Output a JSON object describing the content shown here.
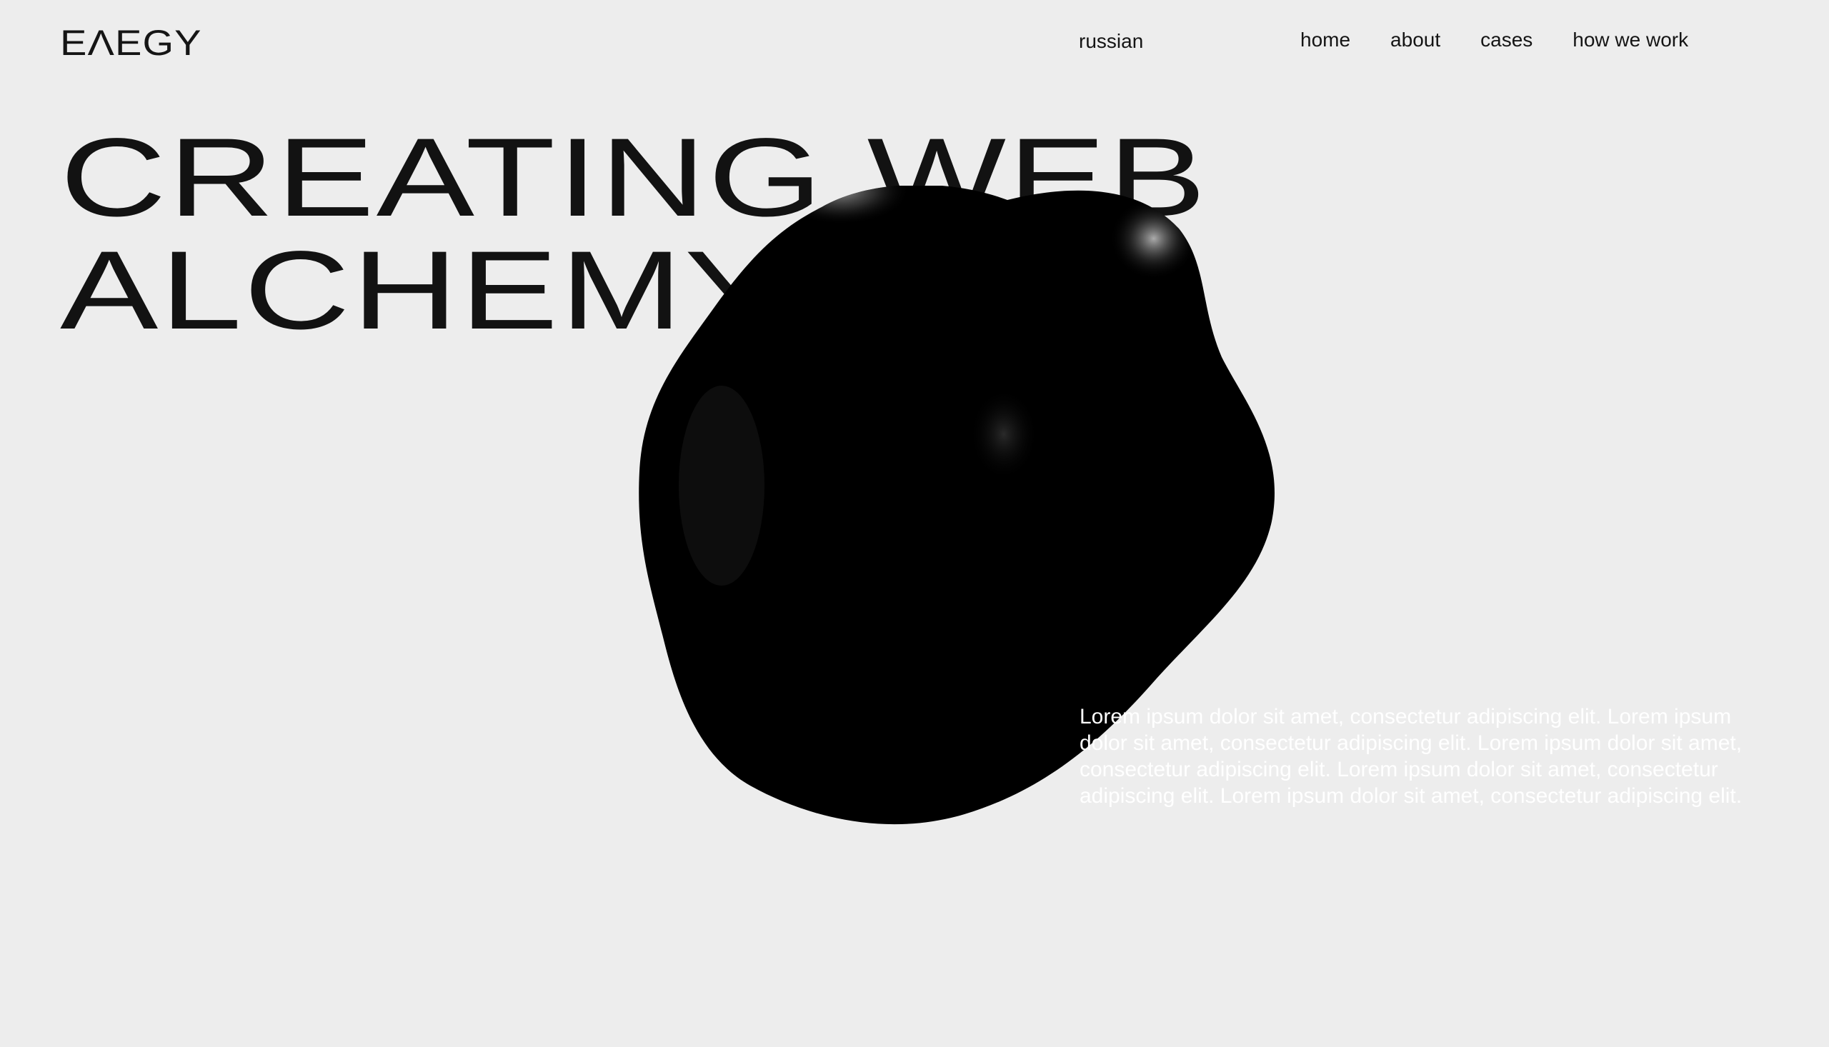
{
  "header": {
    "logo": "EΛEGY",
    "language_label": "russian",
    "nav": [
      {
        "label": "home"
      },
      {
        "label": "about"
      },
      {
        "label": "cases"
      },
      {
        "label": "how we work"
      }
    ]
  },
  "hero": {
    "title_line_1": "CREATING WEB",
    "title_line_2": "ALCHEMY",
    "description": "Lorem ipsum dolor sit amet, consectetur adipiscing elit. Lorem ipsum dolor sit amet, consectetur adipiscing elit. Lorem ipsum dolor sit amet, consectetur adipiscing elit. Lorem ipsum dolor sit amet, consectetur adipiscing elit. Lorem ipsum dolor sit amet, consectetur adipiscing elit."
  },
  "colors": {
    "background": "#ededed",
    "text": "#121212",
    "blob": "#000000"
  },
  "icons": {
    "blob": "3d-black-blob-graphic"
  }
}
